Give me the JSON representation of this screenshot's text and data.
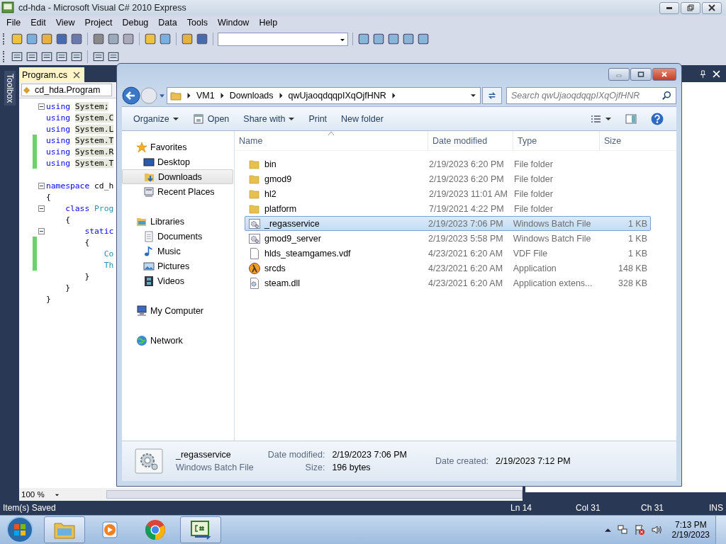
{
  "window": {
    "title": "cd-hda - Microsoft Visual C# 2010 Express"
  },
  "menu": [
    "File",
    "Edit",
    "View",
    "Project",
    "Debug",
    "Data",
    "Tools",
    "Window",
    "Help"
  ],
  "toolbox": {
    "label": "Toolbox"
  },
  "editor": {
    "tab": {
      "label": "Program.cs",
      "selected": true
    },
    "nav": "cd_hda.Program",
    "zoom": "100 %",
    "lines": [
      {
        "kind": "code",
        "fold": true,
        "changed": false,
        "tokens": [
          {
            "text": "using",
            "kind": "keyword"
          },
          {
            "text": " System;",
            "kind": "ref"
          }
        ]
      },
      {
        "kind": "code",
        "fold": false,
        "changed": false,
        "tokens": [
          {
            "text": "using",
            "kind": "keyword"
          },
          {
            "text": " System.C",
            "kind": "ref"
          }
        ]
      },
      {
        "kind": "code",
        "fold": false,
        "changed": false,
        "tokens": [
          {
            "text": "using",
            "kind": "keyword"
          },
          {
            "text": " System.L",
            "kind": "ref"
          }
        ]
      },
      {
        "kind": "code",
        "fold": false,
        "changed": true,
        "tokens": [
          {
            "text": "using",
            "kind": "keyword"
          },
          {
            "text": " System.T",
            "kind": "ref"
          }
        ]
      },
      {
        "kind": "code",
        "fold": false,
        "changed": true,
        "tokens": [
          {
            "text": "using",
            "kind": "keyword"
          },
          {
            "text": " System.R",
            "kind": "ref"
          }
        ]
      },
      {
        "kind": "code",
        "fold": false,
        "changed": true,
        "tokens": [
          {
            "text": "using",
            "kind": "keyword"
          },
          {
            "text": " System.T",
            "kind": "ref"
          }
        ]
      },
      {
        "kind": "blank",
        "fold": false,
        "changed": false
      },
      {
        "kind": "code",
        "fold": true,
        "changed": false,
        "tokens": [
          {
            "text": "namespace",
            "kind": "keyword"
          },
          {
            "text": " cd_h"
          }
        ]
      },
      {
        "kind": "code",
        "fold": false,
        "changed": false,
        "tokens": [
          {
            "text": "{"
          }
        ]
      },
      {
        "kind": "code",
        "fold": true,
        "changed": false,
        "tokens": [
          {
            "text": "    class",
            "kind": "keyword"
          },
          {
            "text": " Prog",
            "kind": "type"
          }
        ]
      },
      {
        "kind": "code",
        "fold": false,
        "changed": false,
        "tokens": [
          {
            "text": "    {"
          }
        ]
      },
      {
        "kind": "code",
        "fold": true,
        "changed": false,
        "tokens": [
          {
            "text": "        static",
            "kind": "keyword"
          }
        ]
      },
      {
        "kind": "code",
        "fold": false,
        "changed": true,
        "tokens": [
          {
            "text": "        {"
          }
        ]
      },
      {
        "kind": "code",
        "fold": false,
        "changed": true,
        "tokens": [
          {
            "text": "            Co",
            "kind": "type"
          }
        ]
      },
      {
        "kind": "code",
        "fold": false,
        "changed": true,
        "tokens": [
          {
            "text": "            Th",
            "kind": "type"
          }
        ]
      },
      {
        "kind": "code",
        "fold": false,
        "changed": false,
        "tokens": [
          {
            "text": "        }"
          }
        ]
      },
      {
        "kind": "code",
        "fold": false,
        "changed": false,
        "tokens": [
          {
            "text": "    }"
          }
        ]
      },
      {
        "kind": "code",
        "fold": false,
        "changed": false,
        "tokens": [
          {
            "text": "}"
          }
        ]
      }
    ]
  },
  "explorer": {
    "breadcrumb": [
      "VM1",
      "Downloads",
      "qwUjaoqdqqpIXqOjfHNR"
    ],
    "search": {
      "placeholder": "Search qwUjaoqdqqpIXqOjfHNR"
    },
    "toolbar": [
      {
        "label": "Organize",
        "dropdown": true,
        "kind": "text"
      },
      {
        "label": "Open",
        "dropdown": false,
        "kind": "open"
      },
      {
        "label": "Share with",
        "dropdown": true,
        "kind": "text"
      },
      {
        "label": "Print",
        "dropdown": false,
        "kind": "text"
      },
      {
        "label": "New folder",
        "dropdown": false,
        "kind": "text"
      }
    ],
    "nav": [
      {
        "label": "Favorites",
        "kind": "star",
        "selected": false,
        "children": [
          {
            "label": "Desktop",
            "kind": "desktop",
            "selected": false
          },
          {
            "label": "Downloads",
            "kind": "downloads",
            "selected": true
          },
          {
            "label": "Recent Places",
            "kind": "recent",
            "selected": false
          }
        ]
      },
      {
        "label": "Libraries",
        "kind": "libraries",
        "selected": false,
        "children": [
          {
            "label": "Documents",
            "kind": "documents",
            "selected": false
          },
          {
            "label": "Music",
            "kind": "music",
            "selected": false
          },
          {
            "label": "Pictures",
            "kind": "pictures",
            "selected": false
          },
          {
            "label": "Videos",
            "kind": "videos",
            "selected": false
          }
        ]
      },
      {
        "label": "My Computer",
        "kind": "computer",
        "selected": false
      },
      {
        "label": "Network",
        "kind": "network",
        "selected": false
      }
    ],
    "columns": [
      {
        "label": "Name",
        "sorted": true
      },
      {
        "label": "Date modified",
        "sorted": false
      },
      {
        "label": "Type",
        "sorted": false
      },
      {
        "label": "Size",
        "sorted": false
      }
    ],
    "rows": [
      {
        "name": "bin",
        "date": "2/19/2023 6:20 PM",
        "type": "File folder",
        "kind": "folder",
        "selected": false
      },
      {
        "name": "gmod9",
        "date": "2/19/2023 6:20 PM",
        "type": "File folder",
        "kind": "folder",
        "selected": false
      },
      {
        "name": "hl2",
        "date": "2/19/2023 11:01 AM",
        "type": "File folder",
        "kind": "folder",
        "selected": false
      },
      {
        "name": "platform",
        "date": "7/19/2021 4:22 PM",
        "type": "File folder",
        "kind": "folder",
        "selected": false
      },
      {
        "name": "_regasservice",
        "date": "2/19/2023 7:06 PM",
        "type": "Windows Batch File",
        "size": "1 KB",
        "kind": "batch",
        "selected": true
      },
      {
        "name": "gmod9_server",
        "date": "2/19/2023 5:58 PM",
        "type": "Windows Batch File",
        "size": "1 KB",
        "kind": "batch",
        "selected": false
      },
      {
        "name": "hlds_steamgames.vdf",
        "date": "4/23/2021 6:20 AM",
        "type": "VDF File",
        "size": "1 KB",
        "kind": "file",
        "selected": false
      },
      {
        "name": "srcds",
        "date": "4/23/2021 6:20 AM",
        "type": "Application",
        "size": "148 KB",
        "kind": "app",
        "selected": false
      },
      {
        "name": "steam.dll",
        "date": "4/23/2021 6:20 AM",
        "type": "Application extens...",
        "size": "328 KB",
        "kind": "dll",
        "selected": false
      }
    ],
    "details": {
      "name": "_regasservice",
      "type": "Windows Batch File",
      "modified_label": "Date modified:",
      "modified": "2/19/2023 7:06 PM",
      "size_label": "Size:",
      "size": "196 bytes",
      "created_label": "Date created:",
      "created": "2/19/2023 7:12 PM"
    }
  },
  "status_bar": {
    "message": "Item(s) Saved",
    "line": "Ln 14",
    "col": "Col 31",
    "ch": "Ch 31",
    "mode": "INS"
  },
  "taskbar": {
    "apps": [
      {
        "kind": "explorer",
        "active": true
      },
      {
        "kind": "media",
        "active": false
      },
      {
        "kind": "chrome",
        "active": false
      },
      {
        "kind": "csharp",
        "active": true
      }
    ],
    "time": "7:13 PM",
    "date": "2/19/2023"
  }
}
